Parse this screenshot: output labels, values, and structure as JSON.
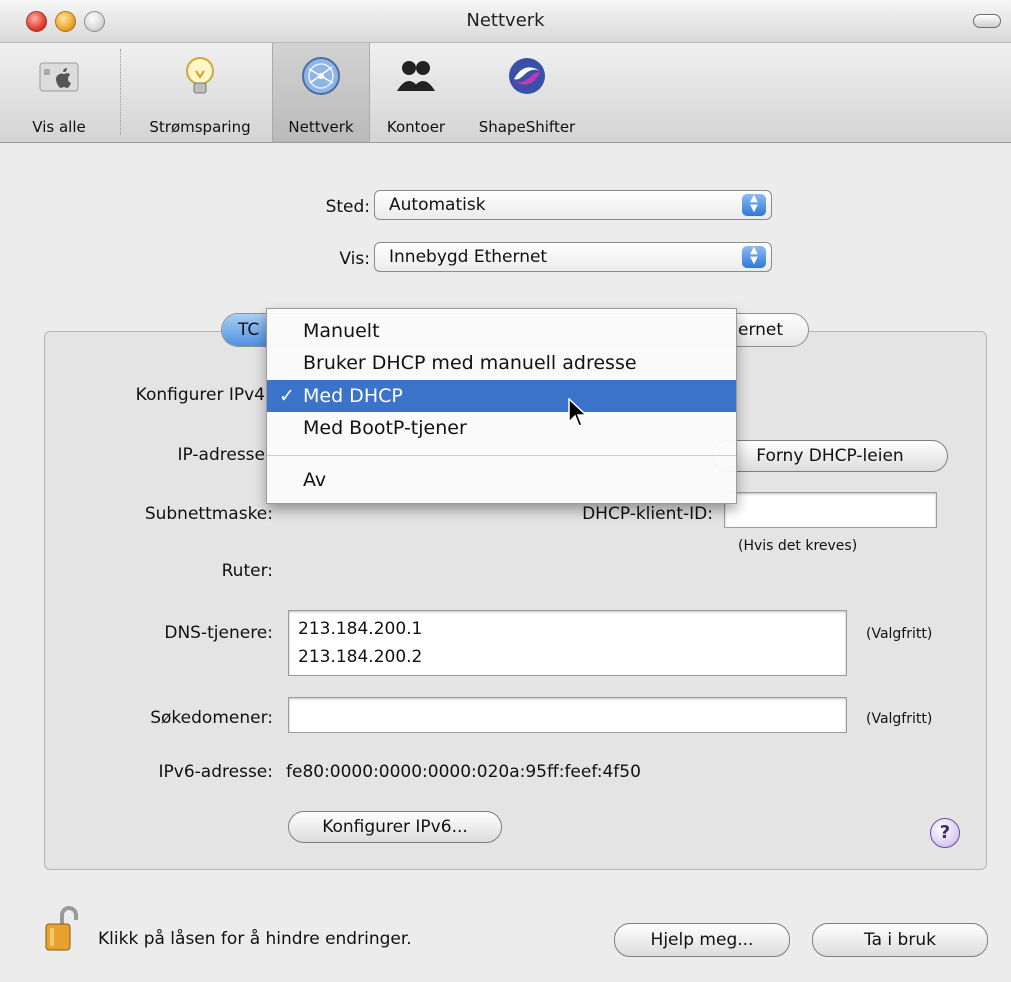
{
  "window": {
    "title": "Nettverk"
  },
  "toolbar": {
    "items": [
      {
        "label": "Vis alle",
        "icon": "apple-grid-icon"
      },
      {
        "label": "Strømsparing",
        "icon": "lightbulb-icon"
      },
      {
        "label": "Nettverk",
        "icon": "globe-network-icon",
        "active": true
      },
      {
        "label": "Kontoer",
        "icon": "users-icon"
      },
      {
        "label": "ShapeShifter",
        "icon": "shapeshifter-icon"
      }
    ]
  },
  "location": {
    "label": "Sted:",
    "value": "Automatisk"
  },
  "show": {
    "label": "Vis:",
    "value": "Innebygd Ethernet"
  },
  "tabs": {
    "first": "TC",
    "second_tail": "ernet"
  },
  "configure_ipv4": {
    "label": "Konfigurer IPv4"
  },
  "menu": {
    "items": [
      {
        "label": "Manuelt"
      },
      {
        "label": "Bruker DHCP med manuell adresse"
      },
      {
        "label": "Med DHCP",
        "checked": true,
        "check": "✓"
      },
      {
        "label": "Med BootP-tjener"
      },
      {
        "label": "Av"
      }
    ]
  },
  "fields": {
    "ip_label": "IP-adresse",
    "subnet_label": "Subnettmaske:",
    "router_label": "Ruter:",
    "dhcp_client_label": "DHCP-klient-ID:",
    "dhcp_client_hint": "(Hvis det kreves)",
    "renew_button": "Forny DHCP-leien",
    "dns_label": "DNS-tjenere:",
    "dns_values": [
      "213.184.200.1",
      "213.184.200.2"
    ],
    "dns_hint": "(Valgfritt)",
    "search_label": "Søkedomener:",
    "search_hint": "(Valgfritt)",
    "ipv6_label": "IPv6-adresse:",
    "ipv6_value": "fe80:0000:0000:0000:020a:95ff:feef:4f50",
    "configure_ipv6_button": "Konfigurer IPv6..."
  },
  "help": {
    "glyph": "?"
  },
  "footer": {
    "lock_text": "Klikk på låsen for å hindre endringer.",
    "help_button": "Hjelp meg...",
    "apply_button": "Ta i bruk"
  }
}
